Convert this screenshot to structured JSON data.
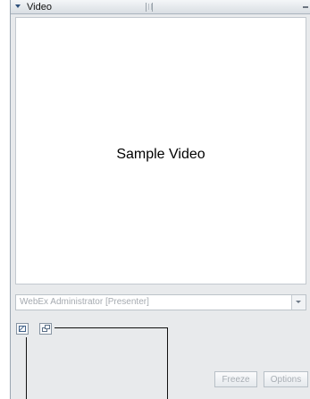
{
  "window": {
    "title": "Video",
    "icons": {
      "collapse": "collapse-arrow-icon",
      "grip": "panel-grip-icon",
      "minimize": "minimize-icon"
    }
  },
  "video": {
    "placeholder_text": "Sample Video"
  },
  "presenter": {
    "selected_value": "WebEx Administrator [Presenter]"
  },
  "controls": {
    "left_icon": "video-settings-icon",
    "right_icon": "window-restore-icon",
    "freeze_label": "Freeze",
    "options_label": "Options"
  }
}
